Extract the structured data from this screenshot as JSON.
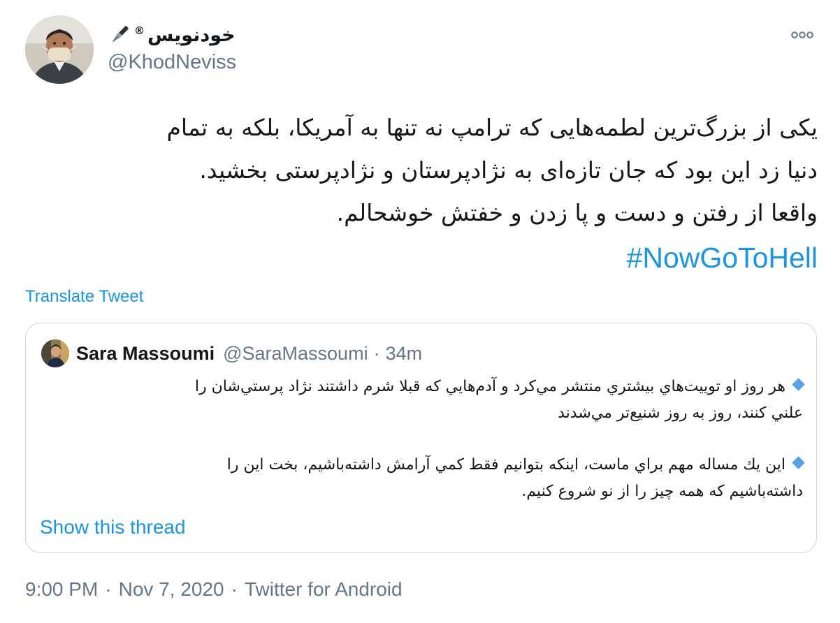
{
  "author": {
    "display_name": "خودنویس",
    "registered_mark": "®",
    "handle": "@KhodNeviss",
    "avatar_icon": "user-avatar-icon",
    "name_badge_icon": "fountain-pen-icon"
  },
  "more_icon": "more-options-icon",
  "tweet": {
    "lines": [
      "یکی از بزرگ‌ترین لطمه‌هایی که ترامپ نه تنها به آمریکا، بلکه به تمام",
      "دنیا زد این بود که جان تازه‌ای به نژادپرستان و نژادپرستی بخشید.",
      "واقعا از رفتن و دست و پا زدن و خفتش خوشحالم."
    ],
    "hashtag": "#NowGoToHell",
    "translate_label": "Translate Tweet"
  },
  "quote": {
    "name": "Sara Massoumi",
    "handle": "@SaraMassoumi",
    "separator": "·",
    "time": "34m",
    "avatar_icon": "user-avatar-icon",
    "bullet_icon": "blue-diamond-icon",
    "paragraph1": [
      "هر روز او توييت‌هاي بيشتري منتشر مي‌كرد و آدم‌هايي كه قبلا شرم داشتند نژاد پرستي‌شان را",
      "علني كنند، روز به روز شنيع‌تر مي‌شدند"
    ],
    "paragraph2": [
      "اين يك مساله مهم براي ماست، اينكه بتوانيم فقط كمي آرامش داشته‌باشيم، بخت اين را",
      "داشته‌باشيم كه همه چيز را از نو شروع كنيم."
    ],
    "show_thread": "Show this thread"
  },
  "footer": {
    "time": "9:00 PM",
    "separator1": "·",
    "date": "Nov 7, 2020",
    "separator2": "·",
    "source": "Twitter for Android"
  },
  "colors": {
    "link": "#1b95e0",
    "secondary_text": "#657786",
    "primary_text": "#14171a",
    "border": "#ccd6dd",
    "bullet": "#5aa0e6"
  }
}
